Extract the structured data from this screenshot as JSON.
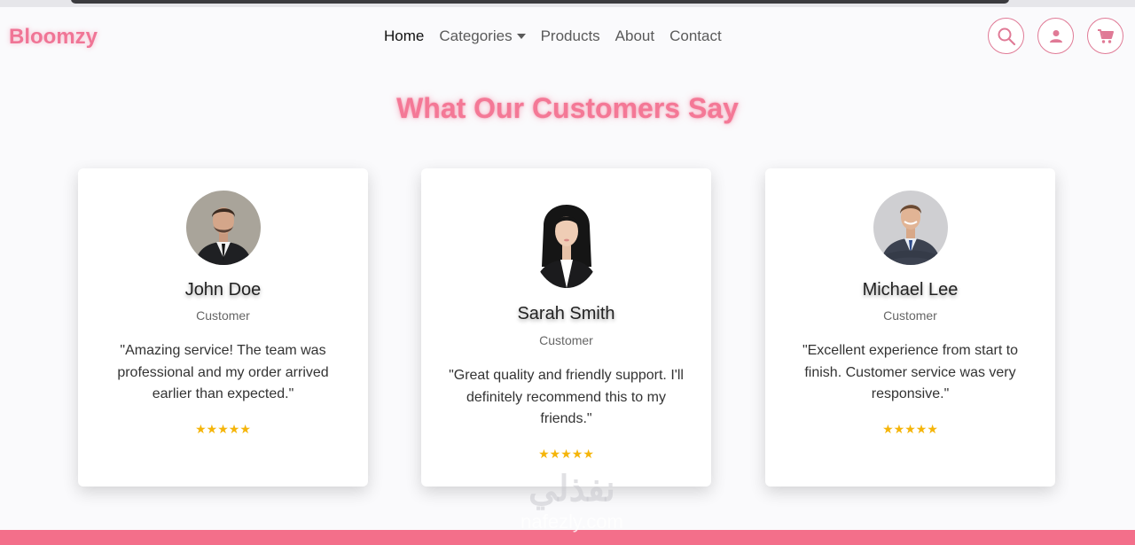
{
  "app": {
    "brand": "Bloomzy"
  },
  "nav": {
    "links": [
      {
        "label": "Home",
        "active": true
      },
      {
        "label": "Categories",
        "dropdown": true
      },
      {
        "label": "Products"
      },
      {
        "label": "About"
      },
      {
        "label": "Contact"
      }
    ],
    "icons": [
      "search-icon",
      "user-icon",
      "cart-icon"
    ]
  },
  "section": {
    "title": "What Our Customers Say"
  },
  "testimonials": [
    {
      "name": "John Doe",
      "role": "Customer",
      "quote": "\"Amazing service! The team was professional and my order arrived earlier than expected.\"",
      "stars": "★★★★★",
      "avatar": "man-in-suit-photo"
    },
    {
      "name": "Sarah Smith",
      "role": "Customer",
      "quote": "\"Great quality and friendly support. I'll definitely recommend this to my friends.\"",
      "stars": "★★★★★",
      "avatar": "woman-in-blazer-photo"
    },
    {
      "name": "Michael Lee",
      "role": "Customer",
      "quote": "\"Excellent experience from start to finish. Customer service was very responsive.\"",
      "stars": "★★★★★",
      "avatar": "smiling-man-arms-crossed-photo"
    }
  ],
  "watermark": {
    "script": "نفذلي",
    "url": "nafezly.com"
  },
  "colors": {
    "brand_pink": "#f07596",
    "footer_pink": "#f36f8a",
    "star_gold": "#f5b50a",
    "background": "#fafafc"
  }
}
